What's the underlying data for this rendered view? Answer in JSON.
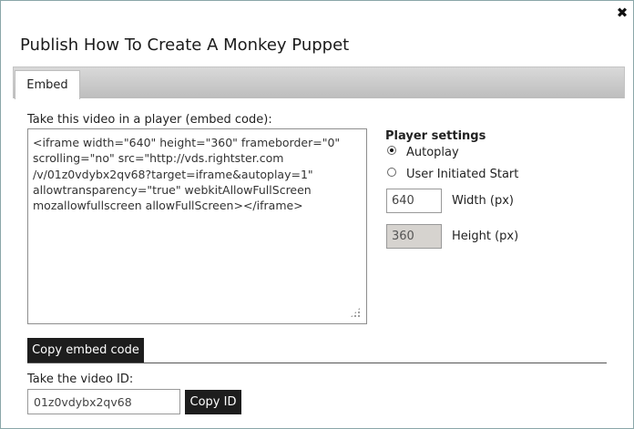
{
  "dialog": {
    "title": "Publish How To Create A Monkey Puppet",
    "close_glyph": "✖"
  },
  "tabs": [
    {
      "label": "Embed",
      "active": true
    }
  ],
  "embed": {
    "label": "Take this video in a player (embed code):",
    "code": "<iframe width=\"640\" height=\"360\" frameborder=\"0\"\nscrolling=\"no\" src=\"http://vds.rightster.com\n/v/01z0vdybx2qv68?target=iframe&autoplay=1\"\nallowtransparency=\"true\" webkitAllowFullScreen\nmozallowfullscreen allowFullScreen></iframe>",
    "copy_button": "Copy embed code"
  },
  "player_settings": {
    "title": "Player settings",
    "start_options": [
      {
        "label": "Autoplay",
        "checked": true
      },
      {
        "label": "User Initiated Start",
        "checked": false
      }
    ],
    "width": {
      "value": "640",
      "label": "Width (px)"
    },
    "height": {
      "value": "360",
      "label": "Height (px)",
      "disabled": true
    }
  },
  "video_id": {
    "label": "Take the video ID:",
    "value": "01z0vdybx2qv68",
    "copy_button": "Copy ID"
  }
}
